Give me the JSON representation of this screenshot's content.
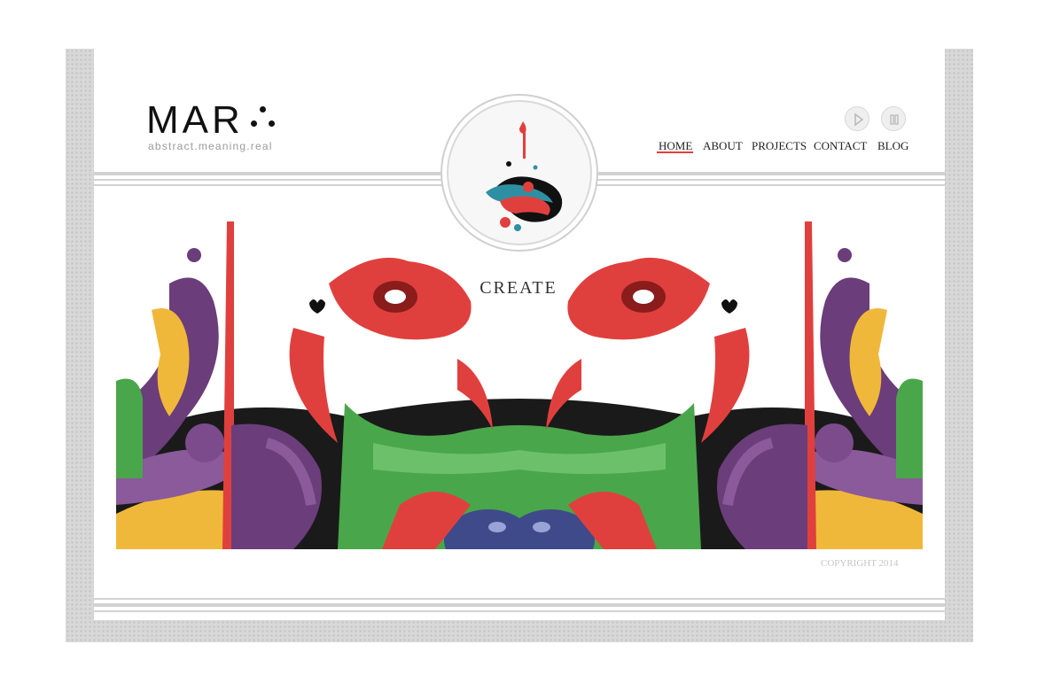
{
  "logo": {
    "text": "MAR",
    "tagline": "abstract.meaning.real"
  },
  "player": {
    "play_icon": "play-icon",
    "pause_icon": "pause-icon"
  },
  "nav": {
    "items": [
      {
        "label": "HOME",
        "active": true
      },
      {
        "label": "ABOUT"
      },
      {
        "label": "PROJECTS"
      },
      {
        "label": "CONTACT"
      },
      {
        "label": "BLOG"
      }
    ],
    "accent": "#e0403d"
  },
  "hero": {
    "title": "CREATE"
  },
  "footer": {
    "copyright": "COPYRIGHT 2014"
  },
  "colors": {
    "red": "#e0403d",
    "purple": "#6b3d7a",
    "green": "#4aa64a",
    "yellow": "#f0b83a",
    "navy": "#3f4a8a",
    "teal": "#2e8fa3"
  }
}
